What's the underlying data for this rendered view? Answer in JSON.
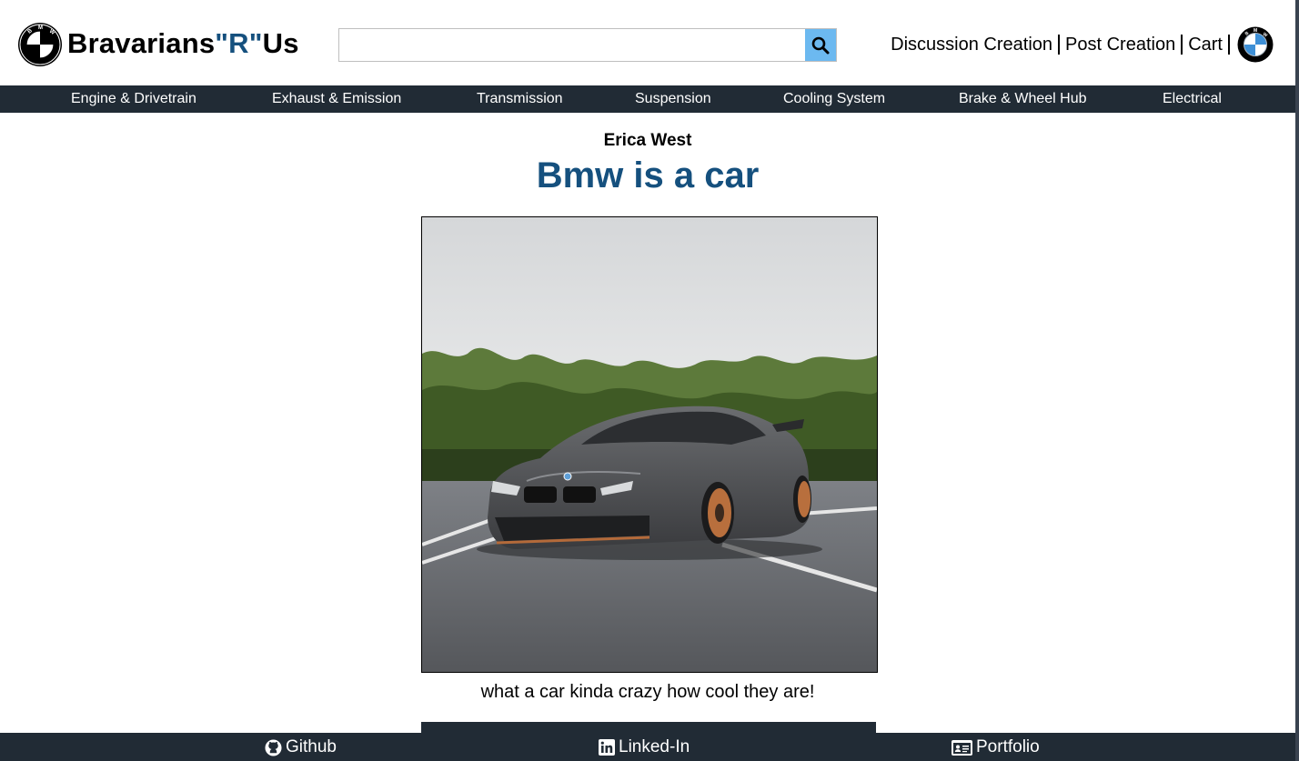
{
  "header": {
    "brand_main": "Bravarians",
    "brand_accent": "\"R\"",
    "brand_tail": "Us",
    "logo_icon": "bmw-roundel-icon",
    "search": {
      "value": "",
      "placeholder": ""
    },
    "links": [
      {
        "label": "Discussion Creation"
      },
      {
        "label": "Post Creation"
      },
      {
        "label": "Cart"
      }
    ]
  },
  "categories": [
    {
      "label": "Engine & Drivetrain"
    },
    {
      "label": "Exhaust & Emission"
    },
    {
      "label": "Transmission"
    },
    {
      "label": "Suspension"
    },
    {
      "label": "Cooling System"
    },
    {
      "label": "Brake & Wheel Hub"
    },
    {
      "label": "Electrical"
    }
  ],
  "post": {
    "author": "Erica West",
    "title": "Bmw is a car",
    "caption": "what a car kinda crazy how cool they are!"
  },
  "footer": {
    "links": [
      {
        "label": "Github",
        "icon": "github-icon"
      },
      {
        "label": "Linked-In",
        "icon": "linkedin-icon"
      },
      {
        "label": "Portfolio",
        "icon": "id-card-icon"
      }
    ]
  },
  "colors": {
    "accent": "#15507e",
    "nav_bg": "#212b35",
    "search_button": "#6cb9f0"
  }
}
